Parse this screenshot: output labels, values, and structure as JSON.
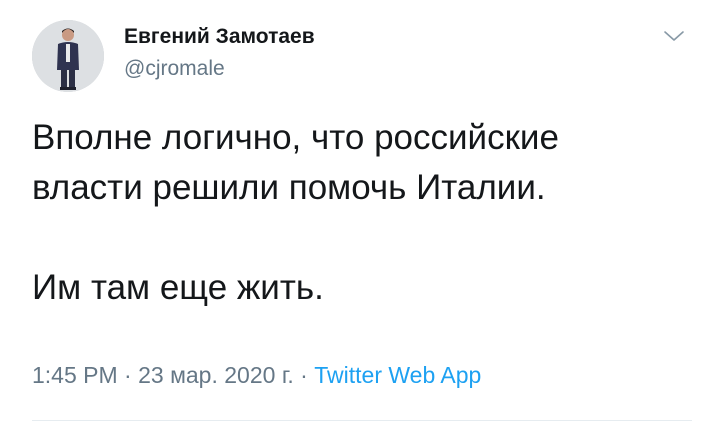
{
  "author": {
    "display_name": "Евгений Замотаев",
    "handle": "@cjromale"
  },
  "tweet": {
    "lines": [
      "Вполне логично, что российские",
      "власти решили помочь Италии."
    ],
    "second_paragraph": "Им там еще жить."
  },
  "meta": {
    "time": "1:45 PM",
    "separator_1": " · ",
    "date": "23 мар. 2020 г.",
    "separator_2": " · ",
    "source": "Twitter Web App"
  },
  "colors": {
    "text_primary": "#14171a",
    "text_secondary": "#657786",
    "link": "#1da1f2"
  },
  "icons": {
    "menu": "chevron-down-icon"
  }
}
